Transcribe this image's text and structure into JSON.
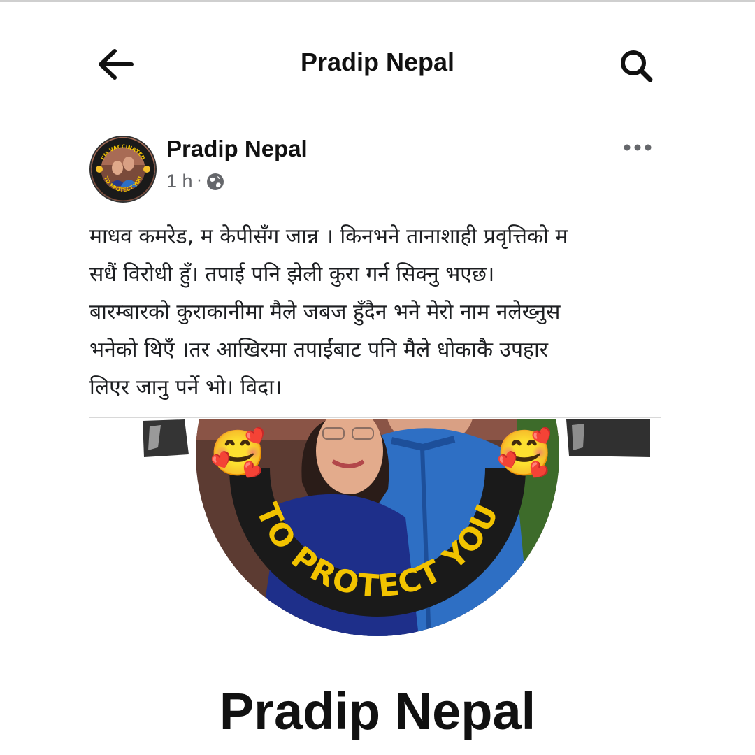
{
  "app_bar": {
    "title": "Pradip Nepal",
    "back_icon": "arrow-left-icon",
    "search_icon": "search-icon"
  },
  "post": {
    "author": "Pradip Nepal",
    "time": "1 h",
    "separator": "·",
    "privacy_icon": "globe-icon",
    "more_icon": "more-horizontal-icon",
    "avatar_badge": {
      "top_text": "I'M VACCINATED",
      "bottom_text": "TO PROTECT YOU"
    },
    "text_lines": [
      "माधव कमरेड,  म केपीसँग जान्न । किनभने तानाशाही प्रवृत्तिको म",
      "सधैं विरोधी हुँ। तपाई पनि झेली कुरा गर्न सिक्नु भएछ।",
      "बारम्बारको कुराकानीमा मैले जबज हुँदैन भने मेरो नाम नलेख्नुस",
      "भनेको थिएँ ।तर आखिरमा तपाईंबाट पनि मैले धोकाकै उपहार",
      "लिएर जानु पर्ने भो। विदा।"
    ]
  },
  "shared_image": {
    "badge_text": "TO PROTECT YOU",
    "emoji": "🥰",
    "profile_name": "Pradip Nepal"
  },
  "colors": {
    "badge_ring": "#1a1a1a",
    "badge_text": "#f2c300",
    "jacket_blue": "#2e6fc4",
    "meta_gray": "#65676b"
  }
}
